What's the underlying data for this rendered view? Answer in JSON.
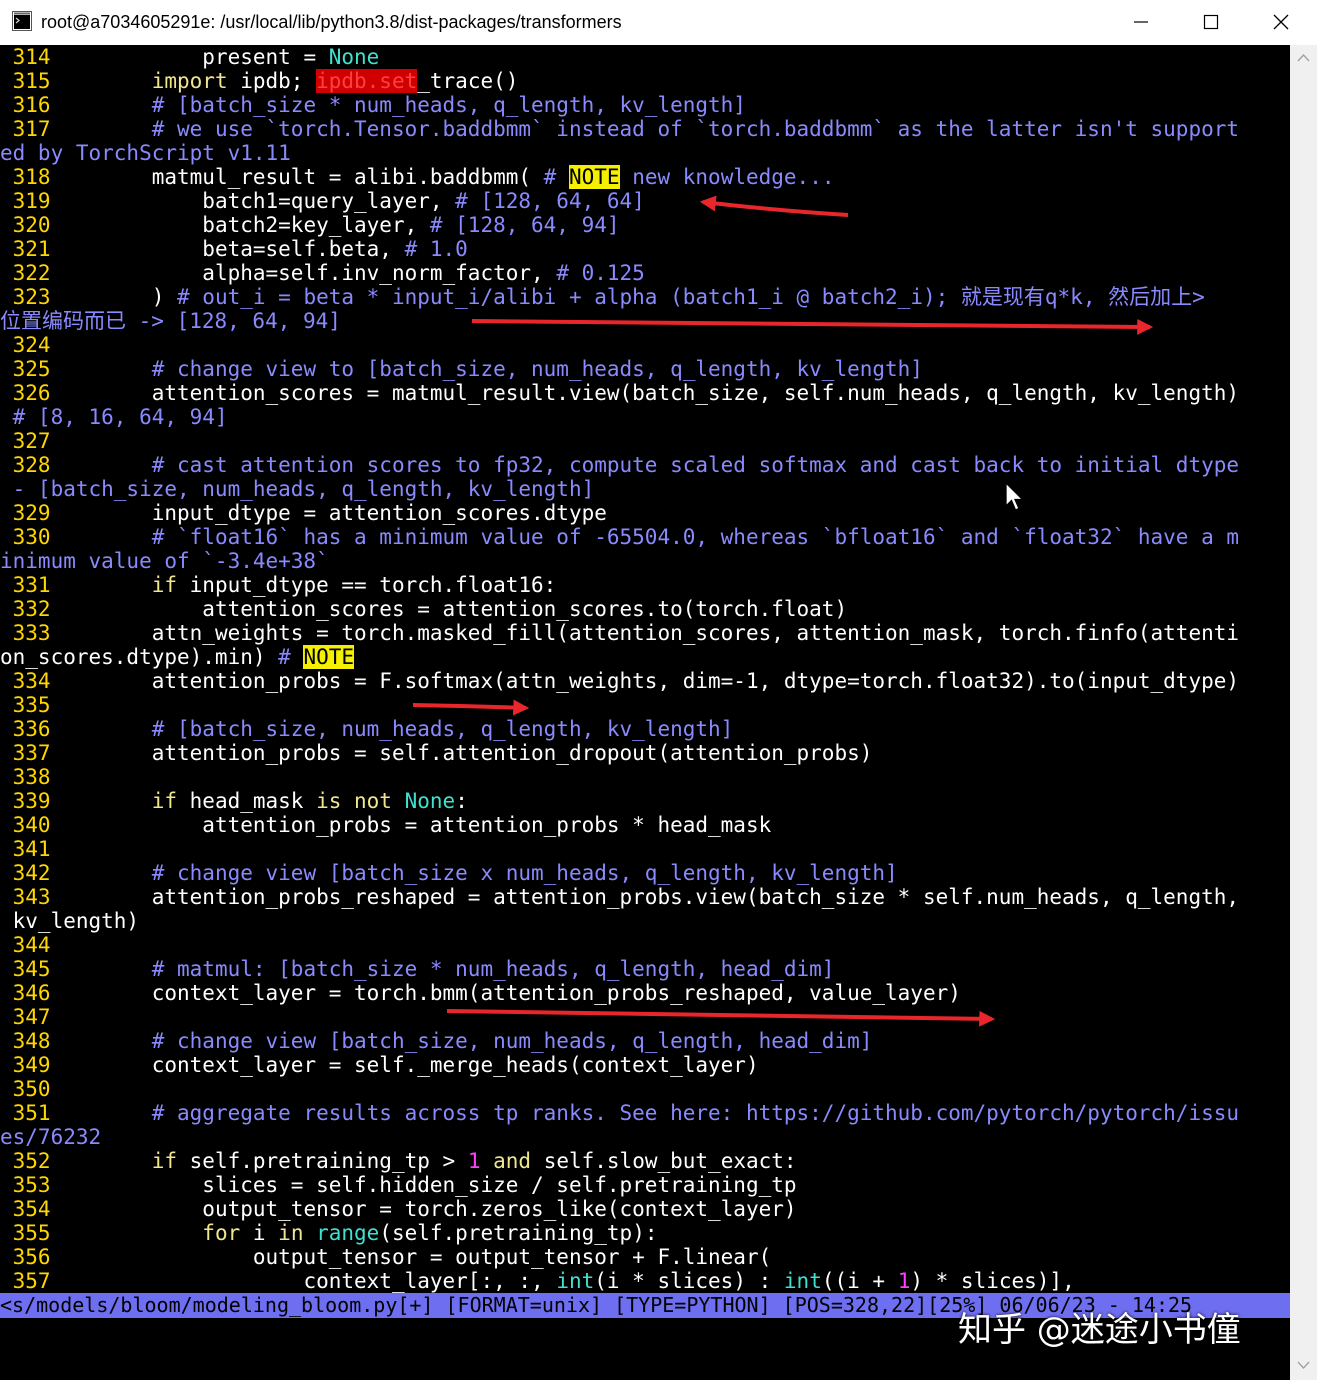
{
  "window": {
    "title": "root@a7034605291e: /usr/local/lib/python3.8/dist-packages/transformers",
    "icon": "terminal-icon",
    "controls": [
      "minimize-icon",
      "maximize-icon",
      "close-icon"
    ]
  },
  "editor": {
    "lines": [
      {
        "ln": "314",
        "segs": [
          [
            "default",
            "            present = "
          ],
          [
            "const",
            "None"
          ]
        ]
      },
      {
        "ln": "315",
        "segs": [
          [
            "keyword",
            "        import "
          ],
          [
            "default",
            "ipdb; "
          ],
          [
            "error",
            "ipdb.set"
          ],
          [
            "default",
            "_trace()"
          ]
        ]
      },
      {
        "ln": "316",
        "segs": [
          [
            "comment",
            "        # [batch_size * num_heads, q_length, kv_length]"
          ]
        ]
      },
      {
        "ln": "317",
        "segs": [
          [
            "comment",
            "        # we use `torch.Tensor.baddbmm` instead of `torch.baddbmm` as the latter isn't support"
          ]
        ]
      },
      {
        "ln": "",
        "segs": [
          [
            "comment",
            "ed by TorchScript v1.11"
          ]
        ]
      },
      {
        "ln": "318",
        "segs": [
          [
            "default",
            "        matmul_result = alibi.baddbmm( "
          ],
          [
            "comment",
            "# "
          ],
          [
            "todo",
            "NOTE"
          ],
          [
            "comment",
            " new knowledge..."
          ]
        ]
      },
      {
        "ln": "319",
        "segs": [
          [
            "default",
            "            batch1=query_layer, "
          ],
          [
            "comment",
            "# [128, 64, 64]"
          ]
        ]
      },
      {
        "ln": "320",
        "segs": [
          [
            "default",
            "            batch2=key_layer, "
          ],
          [
            "comment",
            "# [128, 64, 94]"
          ]
        ]
      },
      {
        "ln": "321",
        "segs": [
          [
            "default",
            "            beta=self.beta, "
          ],
          [
            "comment",
            "# 1.0"
          ]
        ]
      },
      {
        "ln": "322",
        "segs": [
          [
            "default",
            "            alpha=self.inv_norm_factor, "
          ],
          [
            "comment",
            "# 0.125"
          ]
        ]
      },
      {
        "ln": "323",
        "segs": [
          [
            "default",
            "        ) "
          ],
          [
            "comment",
            "# out_i = beta * input_i/alibi + alpha (batch1_i @ batch2_i); 就是现有q*k, 然后加上>"
          ]
        ]
      },
      {
        "ln": "",
        "segs": [
          [
            "comment",
            "位置编码而已 -> [128, 64, 94]"
          ]
        ]
      },
      {
        "ln": "324",
        "segs": []
      },
      {
        "ln": "325",
        "segs": [
          [
            "comment",
            "        # change view to [batch_size, num_heads, q_length, kv_length]"
          ]
        ]
      },
      {
        "ln": "326",
        "segs": [
          [
            "default",
            "        attention_scores = matmul_result.view(batch_size, self.num_heads, q_length, kv_length)"
          ]
        ]
      },
      {
        "ln": "",
        "segs": [
          [
            "comment",
            " # [8, 16, 64, 94]"
          ]
        ]
      },
      {
        "ln": "327",
        "segs": []
      },
      {
        "ln": "328",
        "segs": [
          [
            "comment",
            "        # cast attention scores to fp32, compute scaled softmax and cast back to initial dtype"
          ]
        ]
      },
      {
        "ln": "",
        "segs": [
          [
            "comment",
            " - [batch_size, num_heads, q_length, kv_length]"
          ]
        ]
      },
      {
        "ln": "329",
        "segs": [
          [
            "default",
            "        input_dtype = attention_scores.dtype"
          ]
        ]
      },
      {
        "ln": "330",
        "segs": [
          [
            "comment",
            "        # `float16` has a minimum value of -65504.0, whereas `bfloat16` and `float32` have a m"
          ]
        ]
      },
      {
        "ln": "",
        "segs": [
          [
            "comment",
            "inimum value of `-3.4e+38`"
          ]
        ]
      },
      {
        "ln": "331",
        "segs": [
          [
            "keyword",
            "        if "
          ],
          [
            "default",
            "input_dtype == torch.float16:"
          ]
        ]
      },
      {
        "ln": "332",
        "segs": [
          [
            "default",
            "            attention_scores = attention_scores.to(torch.float)"
          ]
        ]
      },
      {
        "ln": "333",
        "segs": [
          [
            "default",
            "        attn_weights = torch.masked_fill(attention_scores, attention_mask, torch.finfo(attenti"
          ]
        ]
      },
      {
        "ln": "",
        "segs": [
          [
            "default",
            "on_scores.dtype).min) "
          ],
          [
            "comment",
            "# "
          ],
          [
            "todo",
            "NOTE"
          ]
        ]
      },
      {
        "ln": "334",
        "segs": [
          [
            "default",
            "        attention_probs = F.softmax(attn_weights, dim=-1, dtype=torch.float32).to(input_dtype)"
          ]
        ]
      },
      {
        "ln": "335",
        "segs": []
      },
      {
        "ln": "336",
        "segs": [
          [
            "comment",
            "        # [batch_size, num_heads, q_length, kv_length]"
          ]
        ]
      },
      {
        "ln": "337",
        "segs": [
          [
            "default",
            "        attention_probs = self.attention_dropout(attention_probs)"
          ]
        ]
      },
      {
        "ln": "338",
        "segs": []
      },
      {
        "ln": "339",
        "segs": [
          [
            "keyword",
            "        if "
          ],
          [
            "default",
            "head_mask "
          ],
          [
            "keyword",
            "is not "
          ],
          [
            "const",
            "None"
          ],
          [
            "default",
            ":"
          ]
        ]
      },
      {
        "ln": "340",
        "segs": [
          [
            "default",
            "            attention_probs = attention_probs * head_mask"
          ]
        ]
      },
      {
        "ln": "341",
        "segs": []
      },
      {
        "ln": "342",
        "segs": [
          [
            "comment",
            "        # change view [batch_size x num_heads, q_length, kv_length]"
          ]
        ]
      },
      {
        "ln": "343",
        "segs": [
          [
            "default",
            "        attention_probs_reshaped = attention_probs.view(batch_size * self.num_heads, q_length,"
          ]
        ]
      },
      {
        "ln": "",
        "segs": [
          [
            "default",
            " kv_length)"
          ]
        ]
      },
      {
        "ln": "344",
        "segs": []
      },
      {
        "ln": "345",
        "segs": [
          [
            "comment",
            "        # matmul: [batch_size * num_heads, q_length, head_dim]"
          ]
        ]
      },
      {
        "ln": "346",
        "segs": [
          [
            "default",
            "        context_layer = torch.bmm(attention_probs_reshaped, value_layer)"
          ]
        ]
      },
      {
        "ln": "347",
        "segs": []
      },
      {
        "ln": "348",
        "segs": [
          [
            "comment",
            "        # change view [batch_size, num_heads, q_length, head_dim]"
          ]
        ]
      },
      {
        "ln": "349",
        "segs": [
          [
            "default",
            "        context_layer = self._merge_heads(context_layer)"
          ]
        ]
      },
      {
        "ln": "350",
        "segs": []
      },
      {
        "ln": "351",
        "segs": [
          [
            "comment",
            "        # aggregate results across tp ranks. See here: https://github.com/pytorch/pytorch/issu"
          ]
        ]
      },
      {
        "ln": "",
        "segs": [
          [
            "comment",
            "es/76232"
          ]
        ]
      },
      {
        "ln": "352",
        "segs": [
          [
            "keyword",
            "        if "
          ],
          [
            "default",
            "self.pretraining_tp > "
          ],
          [
            "number",
            "1"
          ],
          [
            "keyword",
            " and "
          ],
          [
            "default",
            "self.slow_but_exact:"
          ]
        ]
      },
      {
        "ln": "353",
        "segs": [
          [
            "default",
            "            slices = self.hidden_size / self.pretraining_tp"
          ]
        ]
      },
      {
        "ln": "354",
        "segs": [
          [
            "default",
            "            output_tensor = torch.zeros_like(context_layer)"
          ]
        ]
      },
      {
        "ln": "355",
        "segs": [
          [
            "keyword",
            "            for "
          ],
          [
            "default",
            "i "
          ],
          [
            "keyword",
            "in "
          ],
          [
            "builtin",
            "range"
          ],
          [
            "default",
            "(self.pretraining_tp):"
          ]
        ]
      },
      {
        "ln": "356",
        "segs": [
          [
            "default",
            "                output_tensor = output_tensor + F.linear("
          ]
        ]
      },
      {
        "ln": "357",
        "segs": [
          [
            "default",
            "                    context_layer[:, :, "
          ],
          [
            "builtin",
            "int"
          ],
          [
            "default",
            "(i * slices) : "
          ],
          [
            "builtin",
            "int"
          ],
          [
            "default",
            "((i + "
          ],
          [
            "number",
            "1"
          ],
          [
            "default",
            ") * slices)],"
          ]
        ]
      }
    ],
    "status": "<s/models/bloom/modeling_bloom.py[+] [FORMAT=unix] [TYPE=PYTHON] [POS=328,22][25%] 06/06/23 - 14:25"
  },
  "watermark": "知乎 @迷途小书僮",
  "annotations": [
    "red-arrow",
    "red-arrow",
    "red-arrow",
    "red-arrow"
  ],
  "colors": {
    "background": "#000000",
    "line_number": "#ffd700",
    "comment": "#8a8aff",
    "keyword": "#f0e68c",
    "constant": "#40e0d0",
    "number": "#ff40ff",
    "todo_bg": "#f5f000",
    "error_bg": "#d00000",
    "statusbar_bg": "#6e6ef0",
    "arrow": "#e8262c"
  }
}
